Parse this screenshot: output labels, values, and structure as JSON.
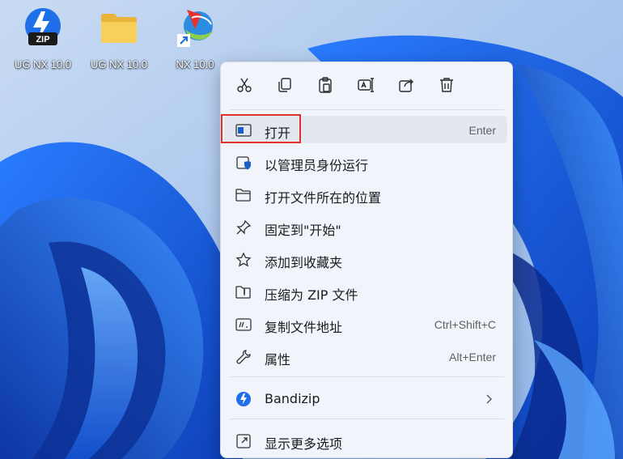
{
  "desktop": {
    "icons": [
      {
        "label": "UG NX 10.0",
        "icon": "bandizip-archive-icon"
      },
      {
        "label": "UG NX 10.0",
        "icon": "folder-icon"
      },
      {
        "label": "NX 10.0",
        "icon": "nx-shortcut-icon"
      }
    ]
  },
  "context_menu": {
    "toolbar": [
      "cut-icon",
      "copy-icon",
      "paste-icon",
      "rename-icon",
      "share-icon",
      "delete-icon"
    ],
    "items": [
      {
        "label": "打开",
        "shortcut": "Enter",
        "icon": "open-window-icon"
      },
      {
        "label": "以管理员身份运行",
        "shortcut": "",
        "icon": "shield-icon"
      },
      {
        "label": "打开文件所在的位置",
        "shortcut": "",
        "icon": "folder-open-icon"
      },
      {
        "label": "固定到\"开始\"",
        "shortcut": "",
        "icon": "pin-icon"
      },
      {
        "label": "添加到收藏夹",
        "shortcut": "",
        "icon": "star-icon"
      },
      {
        "label": "压缩为 ZIP 文件",
        "shortcut": "",
        "icon": "zip-folder-icon"
      },
      {
        "label": "复制文件地址",
        "shortcut": "Ctrl+Shift+C",
        "icon": "copy-path-icon"
      },
      {
        "label": "属性",
        "shortcut": "Alt+Enter",
        "icon": "wrench-icon"
      }
    ],
    "bandizip": {
      "label": "Bandizip",
      "icon": "bandizip-icon"
    },
    "more_options": {
      "label": "显示更多选项",
      "icon": "more-options-icon"
    }
  },
  "colors": {
    "highlight_border": "#e0312d",
    "menu_bg": "#f1f4fb",
    "wallpaper_blue": "#1a5fd8"
  }
}
